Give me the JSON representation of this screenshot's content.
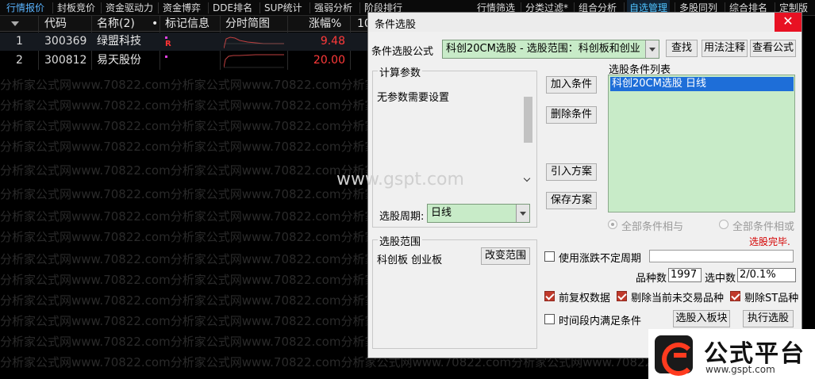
{
  "tabs_left": [
    "行情报价",
    "封板竞价",
    "资金驱动力",
    "资金博弈",
    "DDE排名",
    "SUP统计",
    "强弱分析",
    "阶段排行"
  ],
  "tabs_right": [
    "行情筛选",
    "分类过滤*",
    "组合分析",
    "自选管理",
    "多股同列",
    "综合排名",
    "定制版"
  ],
  "table": {
    "headers": [
      "代码",
      "名称(2)",
      "•",
      "标记信息",
      "分时简图",
      "涨幅%",
      "10"
    ],
    "rows": [
      {
        "idx": "1",
        "code": "300369",
        "name": "绿盟科技",
        "tag": "R",
        "change": "9.48"
      },
      {
        "idx": "2",
        "code": "300812",
        "name": "易天股份",
        "tag": "",
        "change": "20.00"
      }
    ]
  },
  "watermark": {
    "text": "分析家公式网www.70822.com",
    "gspt": "www.gspt.com"
  },
  "dialog": {
    "title": "条件选股",
    "close": "✕",
    "formula_label": "条件选股公式",
    "formula_value": "科创20CM选股  -  选股范围：科创板和创业",
    "btn_find": "查找",
    "btn_usage": "用法注释",
    "btn_view": "查看公式",
    "params_group": "计算参数",
    "params_text": "无参数需要设置",
    "period_label": "选股周期:",
    "period_value": "日线",
    "btn_add": "加入条件",
    "btn_delete": "删除条件",
    "btn_import": "引入方案",
    "btn_save": "保存方案",
    "cond_list_label": "选股条件列表",
    "cond_items": [
      "科创20CM选股  日线"
    ],
    "radio_and": "全部条件相与",
    "radio_or": "全部条件相或",
    "status": "选股完毕.",
    "range_group": "选股范围",
    "range_text": "科创板 创业板",
    "btn_change_range": "改变范围",
    "chk_uncertain": "使用涨跌不定周期",
    "count_label": "品种数",
    "count_value": "1997",
    "selected_label": "选中数",
    "selected_value": "2/0.1%",
    "chk_forward": "前复权数据",
    "chk_exclude_untraded": "剔除当前未交易品种",
    "chk_exclude_st": "剔除ST品种",
    "chk_period_satisfy": "时间段内满足条件",
    "btn_to_block": "选股入板块",
    "btn_execute": "执行选股"
  },
  "logo": {
    "text": "公式平台",
    "url": "www.gspt.com"
  },
  "colors": {
    "up_red": "#ff3a3a",
    "list_green": "#c8ebc8",
    "selection_blue": "#1e6ed8",
    "close_red": "#e81123"
  }
}
